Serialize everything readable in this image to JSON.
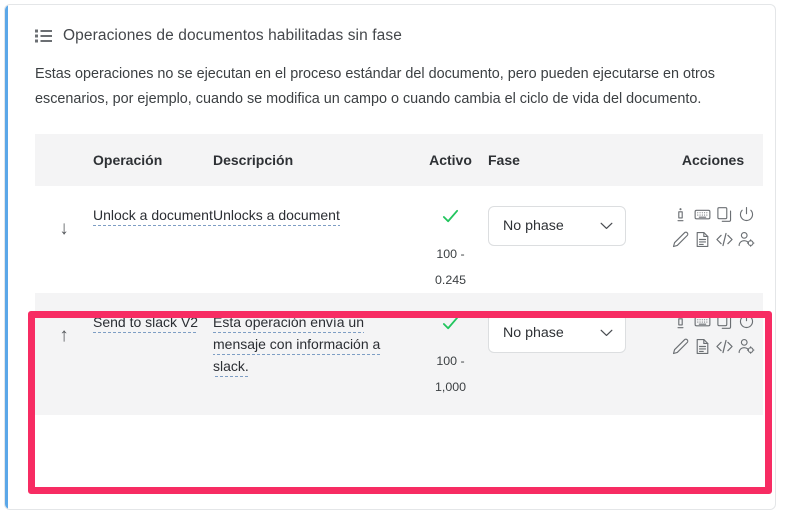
{
  "card": {
    "title": "Operaciones de documentos habilitadas sin fase",
    "title_icon": "list-icon",
    "accent_color": "#5ba7e8",
    "intro": "Estas operaciones no se ejecutan en el proceso estándar del documento, pero pueden ejecutarse en otros escenarios, por ejemplo, cuando se modifica un campo o cuando cambia el ciclo de vida del documento."
  },
  "table": {
    "headers": {
      "arrow": "",
      "operation": "Operación",
      "description": "Descripción",
      "active": "Activo",
      "phase": "Fase",
      "actions": "Acciones"
    },
    "rows": [
      {
        "reorder_arrow": "↓",
        "reorder_arrow_name": "arrow-down-icon",
        "operation": "Unlock a document",
        "description": "Unlocks a document",
        "active_icon": "check-icon",
        "active": true,
        "range_top": "100  -",
        "range_bottom": "0.245",
        "phase": "No phase",
        "actions": [
          "info-icon",
          "keyboard-icon",
          "copy-icon",
          "power-icon",
          "pencil-icon",
          "document-icon",
          "code-icon",
          "user-settings-icon"
        ]
      },
      {
        "reorder_arrow": "↑",
        "reorder_arrow_name": "arrow-up-icon",
        "operation": "Send to slack V2",
        "description": "Esta operación envía un mensaje con información a slack.",
        "active_icon": "check-icon",
        "active": true,
        "range_top": "100  -",
        "range_bottom": "1,000",
        "phase": "No phase",
        "actions": [
          "info-icon",
          "keyboard-icon",
          "copy-icon",
          "power-icon",
          "pencil-icon",
          "document-icon",
          "code-icon",
          "user-settings-icon"
        ]
      }
    ]
  },
  "highlight": {
    "color": "#f72c63",
    "target_row": 1
  },
  "colors": {
    "check_green": "#22c55e",
    "header_bg": "#f4f4f5",
    "link_underline": "#7e9ec4",
    "accent_blue": "#5ba7e8",
    "highlight_pink": "#f72c63"
  }
}
